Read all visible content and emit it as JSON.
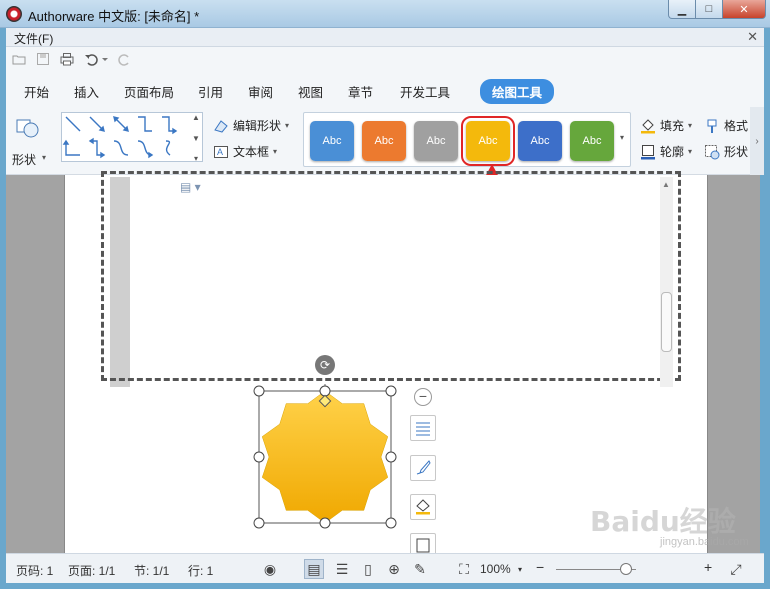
{
  "window": {
    "title": "Authorware 中文版: [未命名] *",
    "min_glyph": "▁",
    "max_glyph": "□",
    "close_glyph": "✕"
  },
  "menu": {
    "file": "文件(F)",
    "close_glyph": "✕"
  },
  "tabs": [
    "开始",
    "插入",
    "页面布局",
    "引用",
    "审阅",
    "视图",
    "章节",
    "开发工具",
    "绘图工具"
  ],
  "active_tab": "绘图工具",
  "ribbon": {
    "shape_label": "形状",
    "edit_shape": "编辑形状",
    "text_box": "文本框",
    "fill": "填充",
    "outline": "轮廓",
    "format": "格式",
    "shape_effect": "形状",
    "style_label": "Abc",
    "styles": [
      {
        "name": "blue",
        "color": "#4a8fd6"
      },
      {
        "name": "orange",
        "color": "#ec7a2f"
      },
      {
        "name": "gray",
        "color": "#a0a0a0"
      },
      {
        "name": "gold",
        "color": "#f4b90c"
      },
      {
        "name": "dark-blue",
        "color": "#3d6fc9"
      },
      {
        "name": "green",
        "color": "#66a73c"
      }
    ],
    "selected_style": "gold",
    "highlight_color": "#e02626"
  },
  "shape": {
    "fill_top": "#ffd24a",
    "fill_bottom": "#f0a800"
  },
  "status": {
    "page_num": "页码: 1",
    "page_total": "页面: 1/1",
    "section": "节: 1/1",
    "line": "行: 1",
    "zoom": "100%",
    "zoom_out": "−",
    "zoom_in": "+"
  },
  "watermark": {
    "text": "Baidu经验",
    "sub": "jingyan.baidu.com"
  }
}
